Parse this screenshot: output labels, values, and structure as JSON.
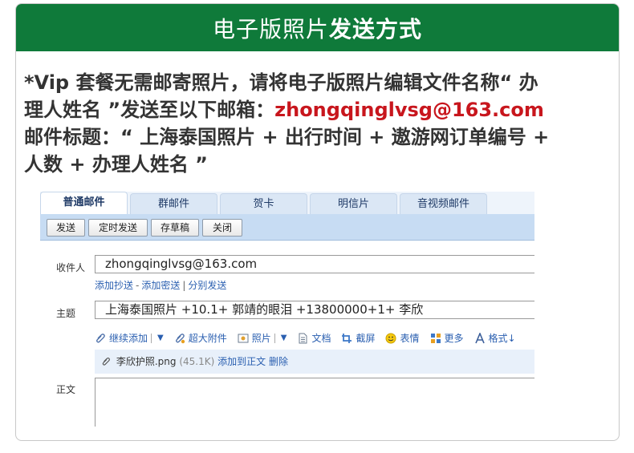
{
  "banner": {
    "title_plain": "电子版照片",
    "title_bold": "发送方式"
  },
  "instructions": {
    "line1": "*Vip 套餐无需邮寄照片，请将电子版照片编辑文件名称“ 办",
    "line2_prefix": "理人姓名 ”发送至以下邮箱：",
    "email": "zhongqinglvsg@163.com",
    "line3": "邮件标题：“ 上海泰国照片 + 出行时间 + 遨游网订单编号 +",
    "line4": "人数 + 办理人姓名 ”"
  },
  "mail": {
    "tabs": [
      "普通邮件",
      "群邮件",
      "贺卡",
      "明信片",
      "音视频邮件"
    ],
    "toolbar": [
      "发送",
      "定时发送",
      "存草稿",
      "关闭"
    ],
    "recipient_label": "收件人",
    "recipient_value": "zhongqinglvsg@163.com",
    "cc_links": {
      "add_cc": "添加抄送",
      "dash": "-",
      "add_bcc": "添加密送",
      "bar": "|",
      "separate": "分别发送"
    },
    "subject_label": "主题",
    "subject_value": "上海泰国照片 +10.1+ 郭靖的眼泪 +13800000+1+ 李欣",
    "attach_bar": {
      "continue_add": "继续添加",
      "large_attach": "超大附件",
      "photo": "照片",
      "document": "文档",
      "screenshot": "截屏",
      "emoji": "表情",
      "more": "更多",
      "format": "格式↓"
    },
    "file": {
      "name": "李欣护照.png",
      "size": "(45.1K)",
      "add_to_body": "添加到正文",
      "delete": "删除"
    },
    "body_label": "正文"
  },
  "colors": {
    "banner": "#0f7a3a",
    "email": "#c8161d",
    "link": "#2a5fb0"
  }
}
